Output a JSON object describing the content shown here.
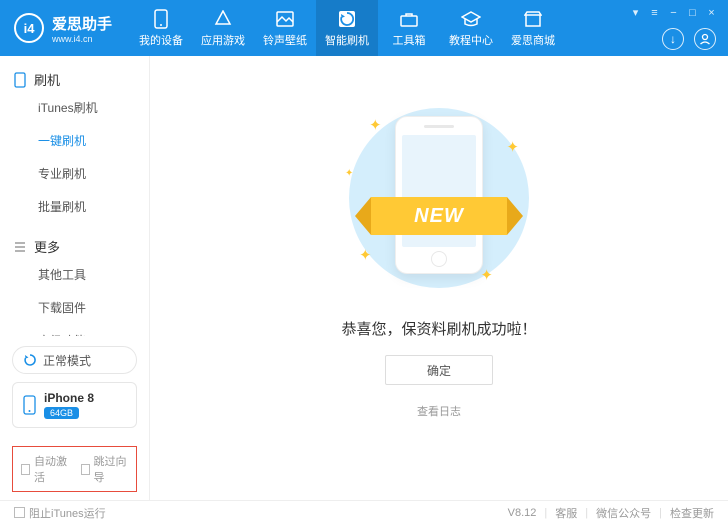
{
  "app": {
    "name": "爱思助手",
    "url": "www.i4.cn",
    "logo": "i4"
  },
  "nav": [
    {
      "label": "我的设备"
    },
    {
      "label": "应用游戏"
    },
    {
      "label": "铃声壁纸"
    },
    {
      "label": "智能刷机",
      "active": true
    },
    {
      "label": "工具箱"
    },
    {
      "label": "教程中心"
    },
    {
      "label": "爱思商城"
    }
  ],
  "sidebar": {
    "groups": [
      {
        "title": "刷机",
        "items": [
          {
            "label": "iTunes刷机"
          },
          {
            "label": "一键刷机",
            "active": true
          },
          {
            "label": "专业刷机"
          },
          {
            "label": "批量刷机"
          }
        ]
      },
      {
        "title": "更多",
        "items": [
          {
            "label": "其他工具"
          },
          {
            "label": "下载固件"
          },
          {
            "label": "高级功能"
          }
        ]
      }
    ],
    "mode": "正常模式",
    "device": {
      "name": "iPhone 8",
      "storage": "64GB"
    },
    "checks": [
      {
        "label": "自动激活"
      },
      {
        "label": "跳过向导"
      }
    ]
  },
  "main": {
    "ribbon": "NEW",
    "message": "恭喜您，保资料刷机成功啦！",
    "ok": "确定",
    "log": "查看日志"
  },
  "footer": {
    "block_itunes": "阻止iTunes运行",
    "version": "V8.12",
    "links": [
      "客服",
      "微信公众号",
      "检查更新"
    ]
  }
}
